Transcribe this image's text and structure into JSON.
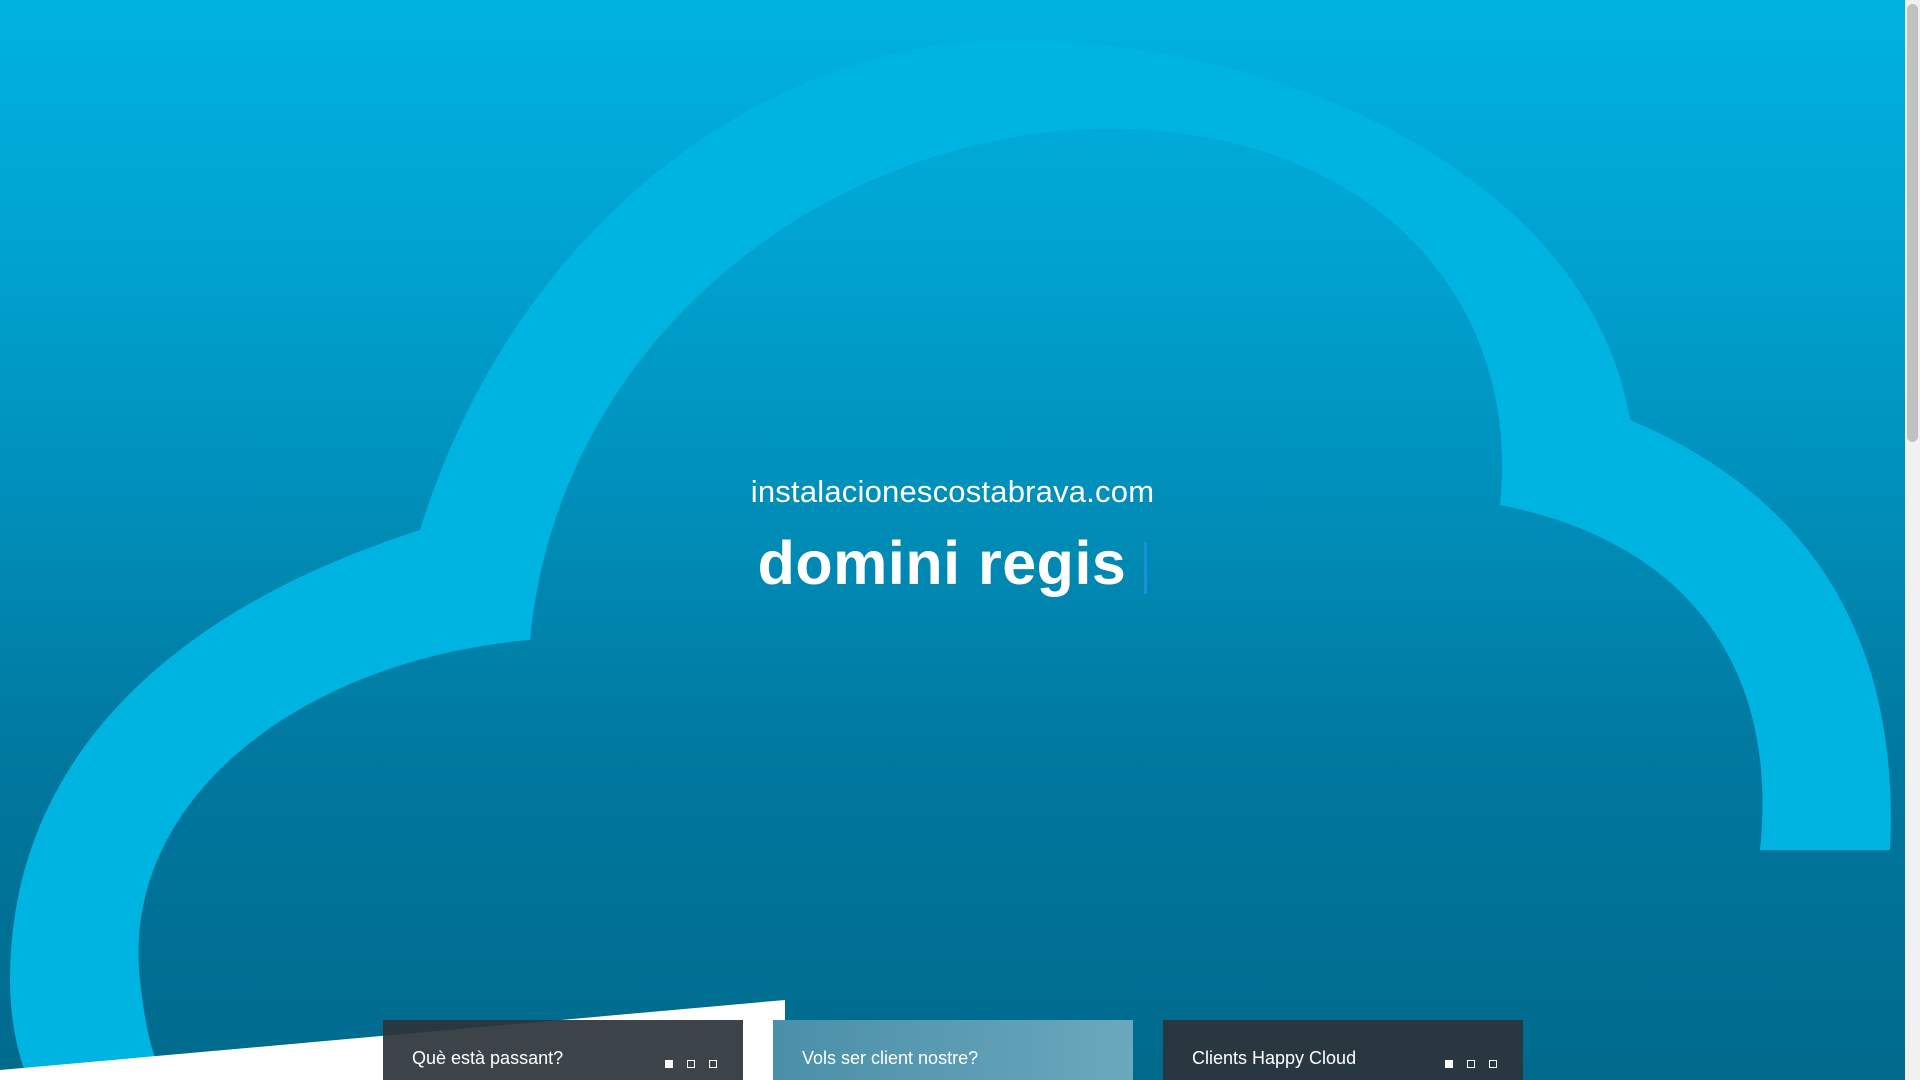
{
  "hero": {
    "domain": "instalacionescostabrava.com",
    "headline": "domini regis"
  },
  "cards": [
    {
      "title": "Què està passant?",
      "show_dots": true,
      "active_dot": 0
    },
    {
      "title": "Vols ser client nostre?",
      "show_dots": false,
      "active_dot": 0
    },
    {
      "title": "Clients Happy Cloud",
      "show_dots": true,
      "active_dot": 0
    }
  ],
  "colors": {
    "background_top": "#00b2e0",
    "background_bottom": "#006a8c",
    "cloud_outline": "#00b4e2",
    "cursor": "#1b8fd8"
  }
}
